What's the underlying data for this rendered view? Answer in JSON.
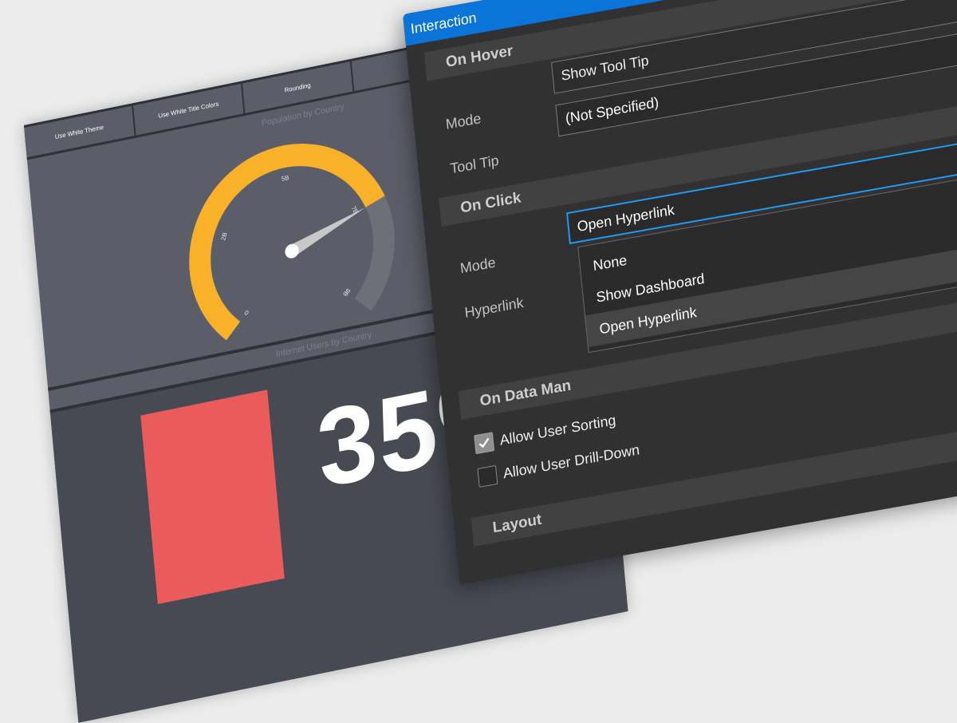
{
  "dashboard": {
    "ribbon_buttons": [
      "Use White Theme",
      "Use White Title Colors",
      "Rounding",
      ""
    ],
    "gauge_caption": "Population by Country",
    "gauge": {
      "tick_labels": [
        "0",
        "2B",
        "5B",
        "7B",
        "9B"
      ],
      "fill_fraction": 0.76,
      "colors": {
        "fill": "#f9b12a",
        "track": "#6d6f79",
        "needle": "#c8c8c8"
      }
    },
    "kpi_caption": "Internet Users by Country",
    "kpi_value": "35%",
    "colors": {
      "panel": "#5b5d68",
      "ribbon": "#2f3038",
      "kpi_block": "#ea5b5c"
    }
  },
  "dialog": {
    "title": "Interaction",
    "on_hover": {
      "header": "On Hover",
      "mode_label": "Mode",
      "mode_value": "Show Tool Tip",
      "tooltip_label": "Tool Tip",
      "tooltip_value": "(Not Specified)"
    },
    "on_click": {
      "header": "On Click",
      "mode_label": "Mode",
      "mode_value": "Open Hyperlink",
      "hyperlink_label": "Hyperlink",
      "options": [
        "None",
        "Show Dashboard",
        "Open Hyperlink"
      ],
      "selected_option": "Open Hyperlink"
    },
    "on_data": {
      "header": "On Data Man",
      "allow_sorting_label": "Allow User Sorting",
      "allow_sorting_checked": true,
      "allow_drilldown_label": "Allow User Drill-Down",
      "allow_drilldown_checked": false
    },
    "layout_header": "Layout",
    "colors": {
      "title_bar": "#0a74d8",
      "focus_border": "#1f9bf0",
      "body": "#313131"
    },
    "icons": {
      "check": "checkmark-icon"
    }
  }
}
